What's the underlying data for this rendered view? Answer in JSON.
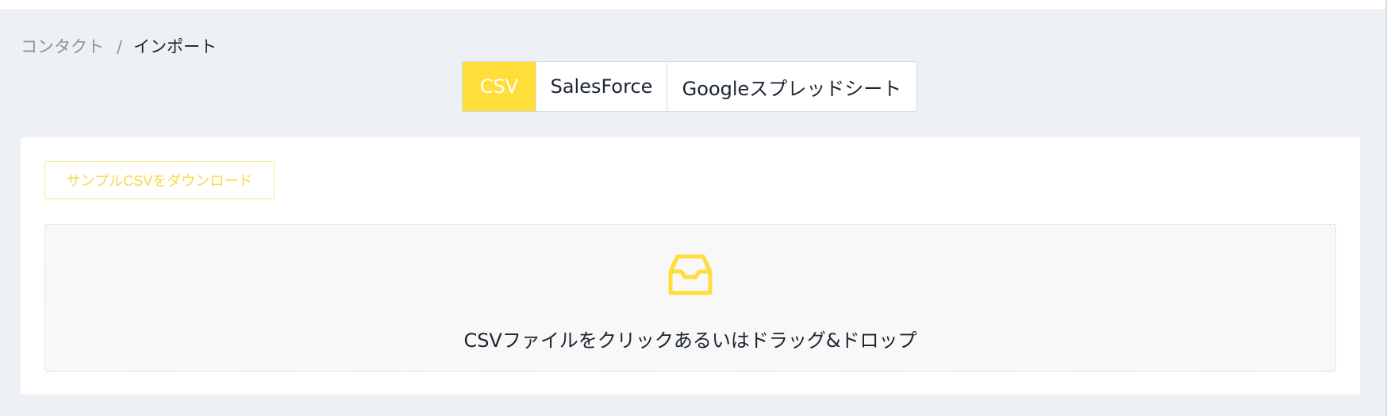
{
  "breadcrumb": {
    "parent": "コンタクト",
    "separator": "/",
    "current": "インポート"
  },
  "tabs": [
    {
      "label": "CSV",
      "active": true
    },
    {
      "label": "SalesForce",
      "active": false
    },
    {
      "label": "Googleスプレッドシート",
      "active": false
    }
  ],
  "sample_download": {
    "label": "サンプルCSVをダウンロード"
  },
  "dropzone": {
    "icon": "inbox-icon",
    "text": "CSVファイルをクリックあるいはドラッグ&ドロップ"
  },
  "colors": {
    "accent": "#ffdd3a",
    "page_background": "#edf0f4",
    "card_background": "#ffffff",
    "dropzone_background": "#f8f8f8",
    "text_primary": "#1b2430",
    "text_muted": "#8b939e"
  }
}
